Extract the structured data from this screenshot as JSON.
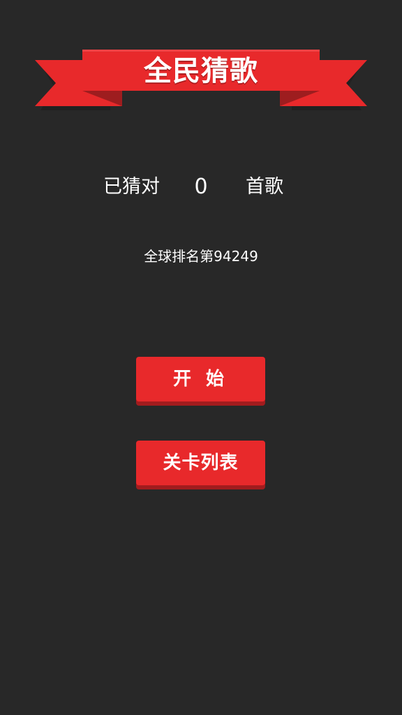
{
  "app": {
    "title": "全民猜歌"
  },
  "score": {
    "prefix": "已猜对",
    "count": "0",
    "suffix": "首歌"
  },
  "ranking": {
    "text": "全球排名第94249"
  },
  "buttons": {
    "start_label": "开 始",
    "levels_label": "关卡列表"
  },
  "colors": {
    "background": "#282828",
    "ribbon": "#e8292b",
    "ribbon_dark": "#a21c1e",
    "text": "#ffffff"
  }
}
